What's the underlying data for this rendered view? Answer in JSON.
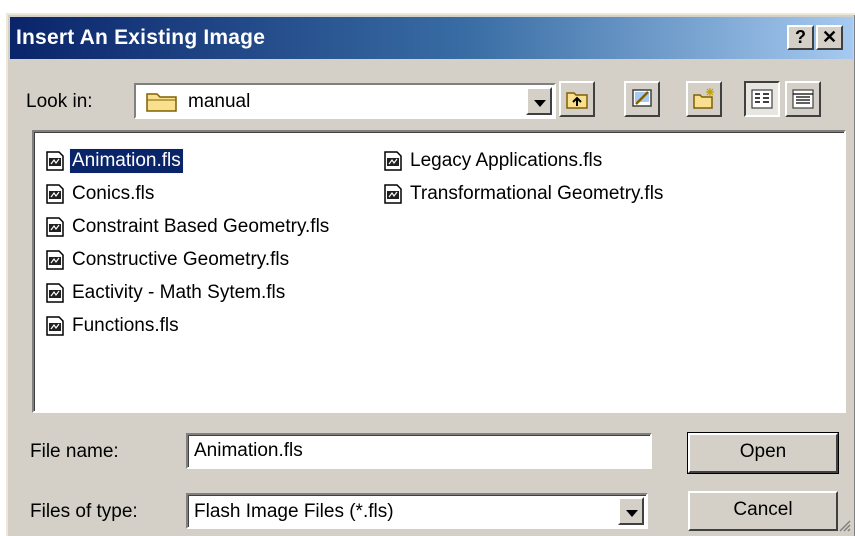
{
  "dialog": {
    "title": "Insert An Existing Image",
    "help_glyph": "?",
    "close_glyph": "✕"
  },
  "look_in": {
    "label": "Look in:",
    "value": "manual",
    "icon": "folder-icon"
  },
  "toolbar": {
    "buttons": [
      "up-one-level-icon",
      "desktop-icon",
      "new-folder-icon",
      "list-view-icon",
      "details-view-icon"
    ]
  },
  "files": {
    "column1": [
      "Animation.fls",
      "Conics.fls",
      "Constraint Based Geometry.fls",
      "Constructive Geometry.fls",
      "Eactivity - Math Sytem.fls",
      "Functions.fls"
    ],
    "column2": [
      "Legacy Applications.fls",
      "Transformational Geometry.fls"
    ],
    "selected": "Animation.fls",
    "icon": "document-icon"
  },
  "file_name": {
    "label": "File name:",
    "value": "Animation.fls"
  },
  "file_type": {
    "label": "Files of type:",
    "value": "Flash Image Files (*.fls)"
  },
  "buttons": {
    "open": "Open",
    "cancel": "Cancel"
  },
  "colors": {
    "title_start": "#0a246a",
    "title_end": "#a6caf0",
    "face": "#d4d0c8",
    "selection": "#0a246a"
  }
}
